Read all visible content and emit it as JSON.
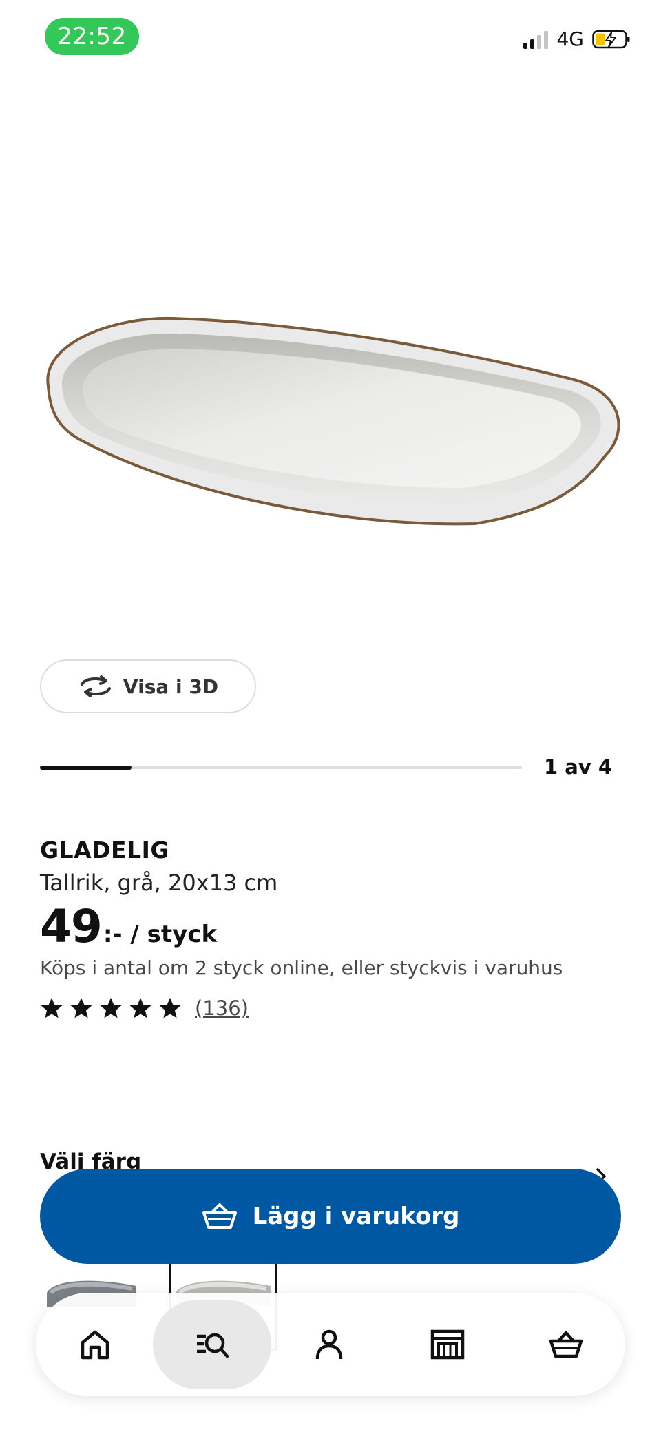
{
  "status_bar": {
    "time": "22:52",
    "network": "4G"
  },
  "gallery": {
    "view3d_label": "Visa i 3D",
    "position_label": "1 av 4",
    "progress": 0.19
  },
  "product": {
    "name": "GLADELIG",
    "description": "Tallrik, grå, 20x13 cm",
    "price_integer": "49",
    "price_suffix": ":- / styck",
    "purchase_note": "Köps i antal om 2 styck online, eller styckvis i varuhus",
    "rating": 5,
    "review_count": "(136)"
  },
  "color_section": {
    "heading": "Välj färg"
  },
  "cart_button": {
    "label": "Lägg i varukorg"
  },
  "colors": {
    "accent": "#0058a3",
    "time_pill": "#34c759"
  },
  "bottom_nav": {
    "items": [
      {
        "icon": "home-icon"
      },
      {
        "icon": "search-icon",
        "active": true
      },
      {
        "icon": "profile-icon"
      },
      {
        "icon": "store-icon"
      },
      {
        "icon": "cart-icon"
      }
    ]
  }
}
